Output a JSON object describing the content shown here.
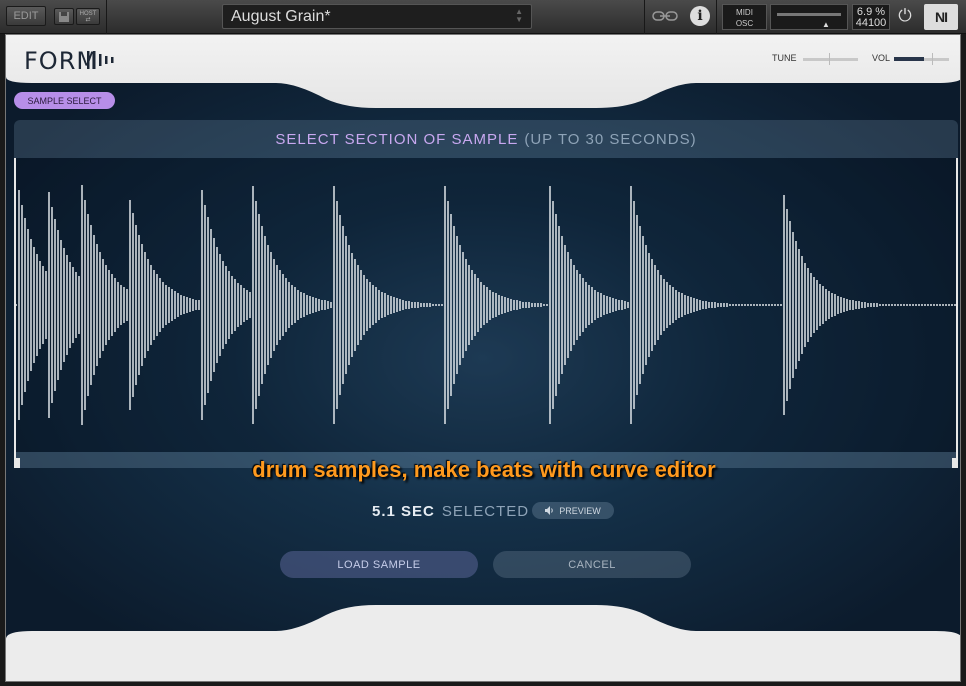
{
  "host": {
    "edit_label": "EDIT",
    "host_label_top": "HOST",
    "host_label_bottom": "⇄",
    "preset_name": "August Grain*",
    "midi_label": "MIDI",
    "osc_label": "OSC",
    "cpu_percent": "6.9 %",
    "sample_rate": "44100",
    "ni_logo": "NI"
  },
  "instrument": {
    "brand": "FORM",
    "tune_label": "TUNE",
    "vol_label": "VOL",
    "vol_level": 0.55,
    "sample_select_label": "SAMPLE SELECT",
    "header_highlight": "SELECT SECTION OF SAMPLE",
    "header_dim": "(UP TO 30 SECONDS)",
    "caption": "drum samples, make beats with curve editor",
    "selected_value": "5.1 SEC",
    "selected_text": "SELECTED",
    "preview_label": "PREVIEW",
    "load_label": "LOAD SAMPLE",
    "cancel_label": "CANCEL"
  },
  "icons": {
    "save": "save-icon",
    "link": "link-icon",
    "info": "info-icon",
    "power": "power-icon",
    "speaker": "speaker-icon"
  },
  "colors": {
    "accent_purple": "#b78ee8",
    "caption_orange": "#ff9a1e",
    "background": "#0e2035"
  }
}
